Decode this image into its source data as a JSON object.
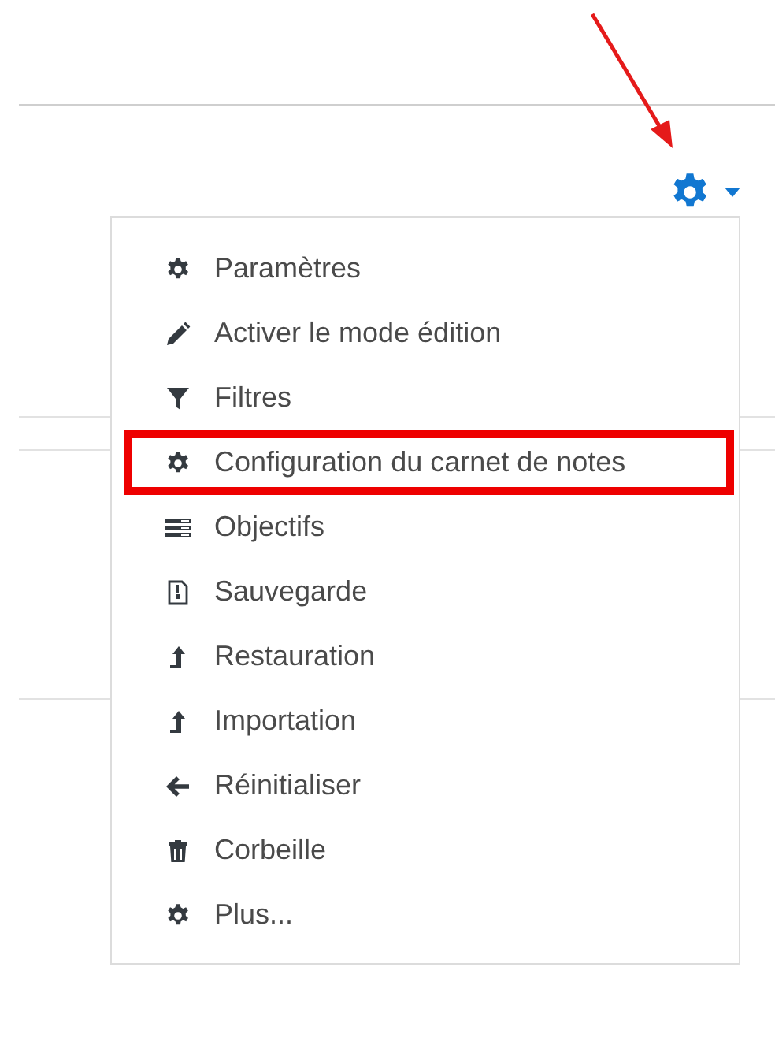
{
  "menu": {
    "items": [
      {
        "label": "Paramètres",
        "kind": "gear",
        "highlighted": false
      },
      {
        "label": "Activer le mode édition",
        "kind": "pencil",
        "highlighted": false
      },
      {
        "label": "Filtres",
        "kind": "filter",
        "highlighted": false
      },
      {
        "label": "Configuration du carnet de notes",
        "kind": "gear",
        "highlighted": true
      },
      {
        "label": "Objectifs",
        "kind": "list",
        "highlighted": false
      },
      {
        "label": "Sauvegarde",
        "kind": "file",
        "highlighted": false
      },
      {
        "label": "Restauration",
        "kind": "levelup",
        "highlighted": false
      },
      {
        "label": "Importation",
        "kind": "levelup",
        "highlighted": false
      },
      {
        "label": "Réinitialiser",
        "kind": "back",
        "highlighted": false
      },
      {
        "label": "Corbeille",
        "kind": "trash",
        "highlighted": false
      },
      {
        "label": "Plus...",
        "kind": "gear",
        "highlighted": false
      }
    ]
  }
}
